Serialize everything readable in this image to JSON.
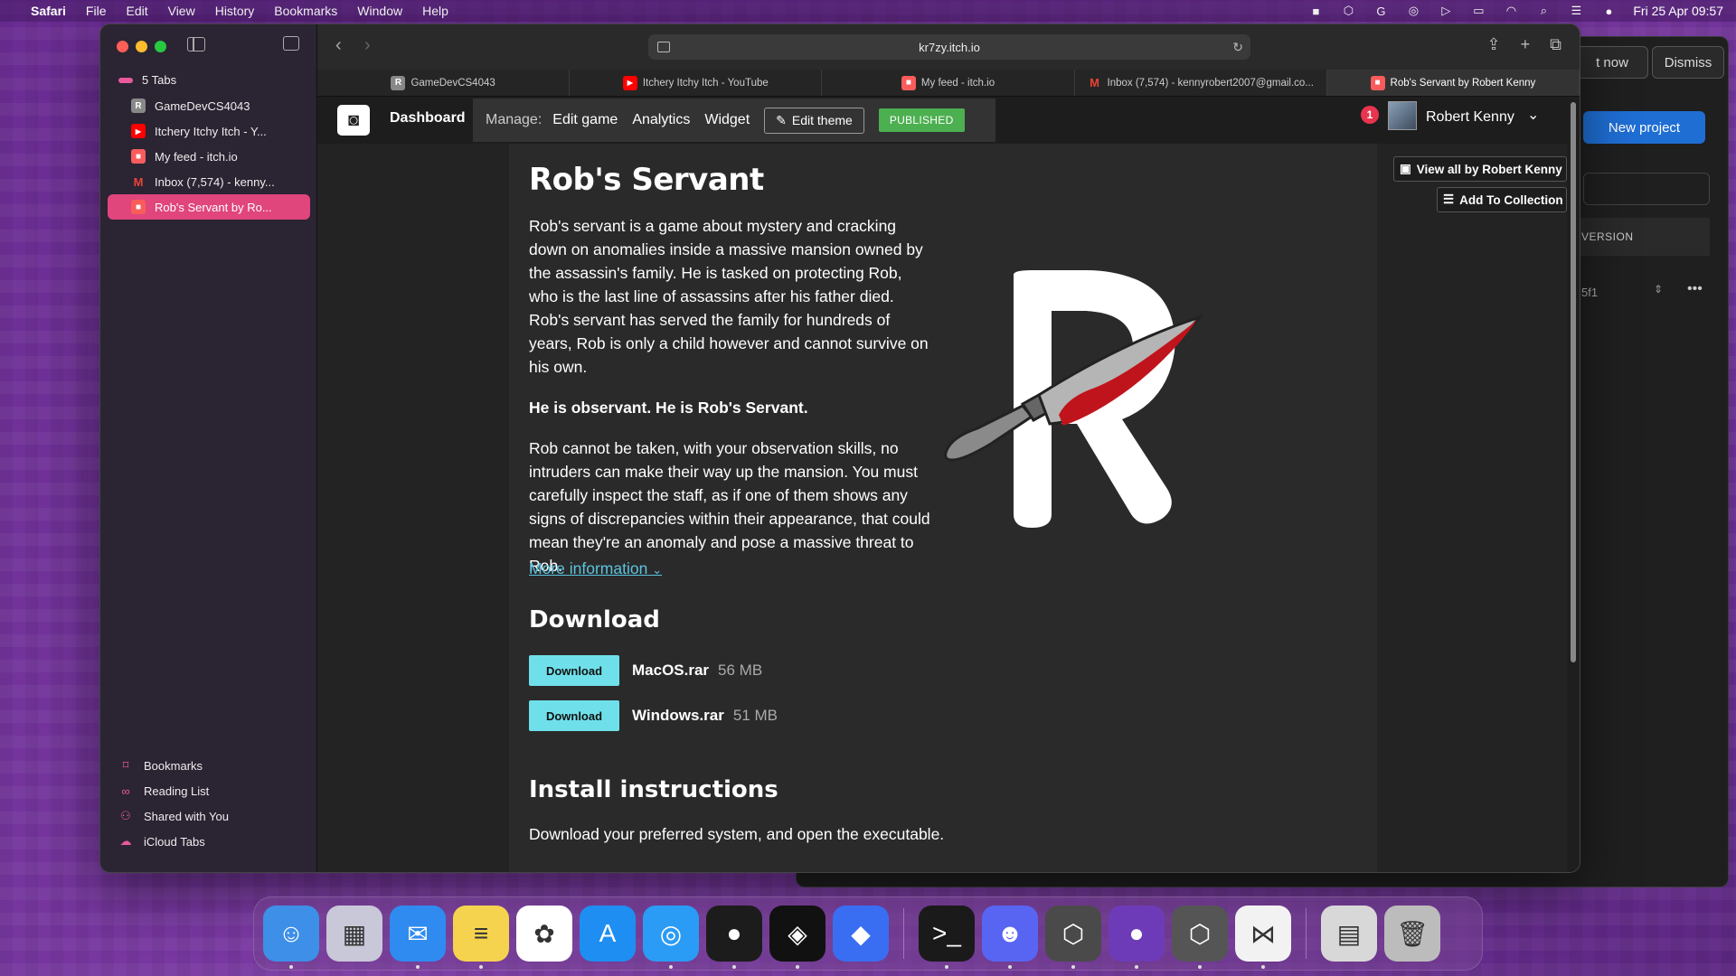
{
  "menubar": {
    "app": "Safari",
    "items": [
      "File",
      "Edit",
      "View",
      "History",
      "Bookmarks",
      "Window",
      "Help"
    ],
    "datetime": "Fri 25 Apr  09:57"
  },
  "background_window": {
    "btn_partial": "t now",
    "dismiss": "Dismiss",
    "new_project": "New project",
    "version_header": "VERSION",
    "row_value": "5f1"
  },
  "sidebar": {
    "group_label": "5 Tabs",
    "tabs": [
      {
        "label": "GameDevCS4043",
        "fav": "R",
        "favtype": "r"
      },
      {
        "label": "Itchery Itchy Itch - Y...",
        "fav": "▶",
        "favtype": "yt"
      },
      {
        "label": "My feed - itch.io",
        "fav": "■",
        "favtype": "itch"
      },
      {
        "label": "Inbox (7,574) - kenny...",
        "fav": "M",
        "favtype": "gmail"
      },
      {
        "label": "Rob's Servant by Ro...",
        "fav": "■",
        "favtype": "itch"
      }
    ],
    "bottom": [
      {
        "label": "Bookmarks",
        "icon": "bookmark-icon"
      },
      {
        "label": "Reading List",
        "icon": "reading-list-icon"
      },
      {
        "label": "Shared with You",
        "icon": "shared-icon"
      },
      {
        "label": "iCloud Tabs",
        "icon": "cloud-icon"
      }
    ]
  },
  "toolbar": {
    "url": "kr7zy.itch.io"
  },
  "tabbar": {
    "tabs": [
      {
        "label": "GameDevCS4043",
        "fav": "R",
        "favtype": "r"
      },
      {
        "label": "Itchery Itchy Itch - YouTube",
        "fav": "▶",
        "favtype": "yt"
      },
      {
        "label": "My feed - itch.io",
        "fav": "■",
        "favtype": "itch"
      },
      {
        "label": "Inbox (7,574) - kennyrobert2007@gmail.co...",
        "fav": "M",
        "favtype": "gmail"
      },
      {
        "label": "Rob's Servant by Robert Kenny",
        "fav": "■",
        "favtype": "itch"
      }
    ]
  },
  "itch_header": {
    "dashboard": "Dashboard",
    "manage_label": "Manage:",
    "edit_game": "Edit game",
    "analytics": "Analytics",
    "widget": "Widget",
    "edit_theme": "Edit theme",
    "published": "PUBLISHED",
    "notification_count": "1",
    "user_name": "Robert Kenny"
  },
  "game": {
    "title": "Rob's Servant",
    "paragraph1": "Rob's servant is a game about mystery and cracking down on anomalies inside a massive mansion owned by the assassin's family. He is tasked on protecting Rob, who is the last line of assassins after his father died. Rob's servant has served the family for hundreds of years, Rob is only a child however and cannot survive on his own.",
    "paragraph2": "He is observant. He is Rob's Servant.",
    "paragraph3": "Rob cannot be taken, with your observation skills, no intruders can make their way up the mansion. You must carefully inspect the staff, as if one of them shows any signs of discrepancies within their appearance, that could mean they're an anomaly and pose a massive threat to Rob.",
    "more_info": "More information",
    "download_heading": "Download",
    "downloads": [
      {
        "button": "Download",
        "file": "MacOS.rar",
        "size": "56 MB"
      },
      {
        "button": "Download",
        "file": "Windows.rar",
        "size": "51 MB"
      }
    ],
    "install_heading": "Install instructions",
    "install_text": "Download your preferred system, and open the executable."
  },
  "side_buttons": {
    "view_all": "View all by Robert Kenny",
    "add_collection": "Add To Collection"
  },
  "colors": {
    "accent_link": "#5bc4e0",
    "download_button": "#6fe0ea",
    "published": "#4caf50",
    "active_tab": "#e0457c"
  },
  "dock": [
    {
      "name": "finder-icon",
      "glyph": "☺",
      "bg": "#3d8fe8",
      "dot": true
    },
    {
      "name": "launchpad-icon",
      "glyph": "▦",
      "bg": "#c8c8d8",
      "dot": false
    },
    {
      "name": "mail-icon",
      "glyph": "✉",
      "bg": "#2f8bf0",
      "dot": true
    },
    {
      "name": "notes-icon",
      "glyph": "≡",
      "bg": "#f5d34f",
      "dot": true
    },
    {
      "name": "photos-icon",
      "glyph": "✿",
      "bg": "#ffffff",
      "dot": false
    },
    {
      "name": "app-store-icon",
      "glyph": "A",
      "bg": "#1f8ef2",
      "dot": false
    },
    {
      "name": "safari-icon",
      "glyph": "◎",
      "bg": "#2a9cf5",
      "dot": true
    },
    {
      "name": "recorder-icon",
      "glyph": "●",
      "bg": "#1c1c1c",
      "dot": true
    },
    {
      "name": "unity-hub-icon",
      "glyph": "◈",
      "bg": "#111111",
      "dot": true
    },
    {
      "name": "roblox-icon",
      "glyph": "◆",
      "bg": "#3a6ef2",
      "dot": false
    },
    {
      "name": "sep"
    },
    {
      "name": "terminal-icon",
      "glyph": ">_",
      "bg": "#1a1a1a",
      "dot": true
    },
    {
      "name": "discord-icon",
      "glyph": "☻",
      "bg": "#5865f2",
      "dot": true
    },
    {
      "name": "unity-icon",
      "glyph": "⬡",
      "bg": "#4a4a4a",
      "dot": true
    },
    {
      "name": "github-icon",
      "glyph": "●",
      "bg": "#6e3bb8",
      "dot": true
    },
    {
      "name": "unity6-icon",
      "glyph": "⬡",
      "bg": "#555555",
      "dot": true
    },
    {
      "name": "vscode-icon",
      "glyph": "⋈",
      "bg": "#f2f2f2",
      "dot": true
    },
    {
      "name": "sep"
    },
    {
      "name": "downloads-icon",
      "glyph": "▤",
      "bg": "#d8d8d8",
      "dot": false
    },
    {
      "name": "trash-icon",
      "glyph": "🗑",
      "bg": "#bcbcbc",
      "dot": false
    }
  ]
}
